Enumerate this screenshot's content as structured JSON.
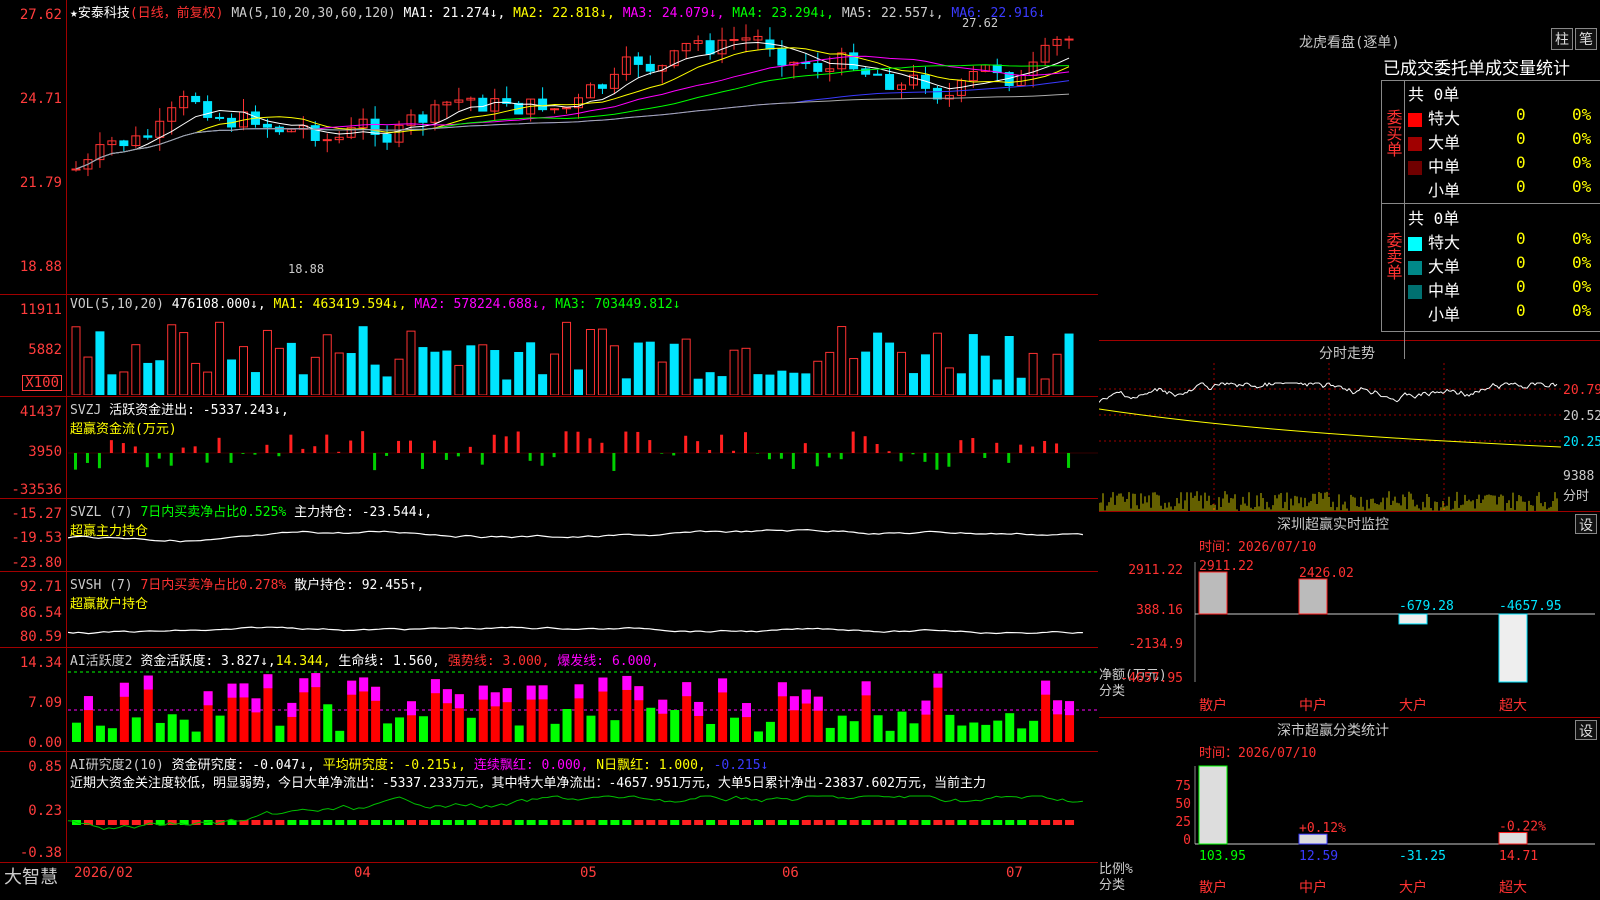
{
  "chart_header": {
    "star": "★",
    "stock": "安泰科技",
    "mode": "(日线，前复权)",
    "ma_prefix": "MA(5,10,20,30,60,120)",
    "ma1": "MA1: 21.274↓,",
    "ma2": "MA2: 22.818↓,",
    "ma3": "MA3: 24.079↓,",
    "ma4": "MA4: 23.294↓,",
    "ma5": "MA5: 22.557↓,",
    "ma6": "MA6: 22.916↓",
    "max_label": "27.62",
    "min_label": "18.88"
  },
  "colors": {
    "up": "#ff3232",
    "down": "#00e5ff",
    "ma1": "#ffffff",
    "ma2": "#ffff00",
    "ma3": "#ff00ff",
    "ma4": "#00ff00",
    "ma5": "#3a3aff",
    "ma6": "#aaaaaa",
    "axis": "#a00000"
  },
  "price_axis": [
    "27.62",
    "24.71",
    "21.79",
    "18.88"
  ],
  "vol_header": {
    "name": "VOL(5,10,20)",
    "v": "476108.000↓,",
    "m1": "MA1: 463419.594↓,",
    "m2": "MA2: 578224.688↓,",
    "m3": "MA3: 703449.812↓"
  },
  "vol_axis": [
    "11911",
    "5882",
    "X100"
  ],
  "svzj_header": {
    "name": "SVZJ",
    "l1": "活跃资金进出: -5337.243↓,",
    "l2": "超赢资金流(万元)"
  },
  "svzj_axis": [
    "41437",
    "3950",
    "-33536"
  ],
  "svzl_header": {
    "name": "SVZL (7)",
    "l1": "7日内买卖净占比0.525%",
    "l2": "主力持仓: -23.544↓,",
    "l3": "超赢主力持仓"
  },
  "svzl_axis": [
    "-15.27",
    "-19.53",
    "-23.80"
  ],
  "svsh_header": {
    "name": "SVSH (7)",
    "l1": "7日内买卖净占比0.278%",
    "l2": "散户持仓: 92.455↑,",
    "l3": "超赢散户持仓"
  },
  "svsh_axis": [
    "92.71",
    "86.54",
    "80.59"
  ],
  "ai1_header": {
    "name": "AI活跃度2",
    "l1": "资金活跃度: 3.827↓,",
    "l2": "14.344,",
    "l3": "生命线: 1.560,",
    "l4": "强势线: 3.000,",
    "l5": "爆发线: 6.000,"
  },
  "ai1_axis": [
    "14.34",
    "7.09",
    "0.00"
  ],
  "ai2_header": {
    "name": "AI研究度2(10)",
    "l1": "资金研究度: -0.047↓,",
    "l2": "平均研究度: -0.215↓,",
    "l3": "连续飘红: 0.000,",
    "l4": "N日飘红: 1.000,",
    "l5": "-0.215↓"
  },
  "ai2_text": "近期大资金关注度较低，明显弱势，今日大单净流出：-5337.233万元，其中特大单净流出：-4657.951万元，大单5日累计净出-23837.602万元，当前主力",
  "ai2_axis": [
    "0.85",
    "0.23",
    "-0.38"
  ],
  "footer": {
    "brand": "大智慧",
    "dates": [
      "2026/02",
      "04",
      "05",
      "06",
      "07"
    ]
  },
  "longhu": {
    "title": "龙虎看盘(逐单)",
    "btn1": "柱",
    "btn2": "笔",
    "tabs": "已成交委托单成交量统计",
    "buy": {
      "label": "委买单",
      "total": "共 0单",
      "rows": [
        {
          "name": "特大",
          "v": "0",
          "p": "0%"
        },
        {
          "name": "大单",
          "v": "0",
          "p": "0%"
        },
        {
          "name": "中单",
          "v": "0",
          "p": "0%"
        },
        {
          "name": "小单",
          "v": "0",
          "p": "0%"
        }
      ]
    },
    "sell": {
      "label": "委卖单",
      "total": "共 0单",
      "rows": [
        {
          "name": "特大",
          "v": "0",
          "p": "0%"
        },
        {
          "name": "大单",
          "v": "0",
          "p": "0%"
        },
        {
          "name": "中单",
          "v": "0",
          "p": "0%"
        },
        {
          "name": "小单",
          "v": "0",
          "p": "0%"
        }
      ]
    }
  },
  "fenshi": {
    "title": "分时走势",
    "axis": [
      "20.79",
      "20.52",
      "20.25"
    ],
    "vol": "9388",
    "label": "分时"
  },
  "realtime": {
    "title": "深圳超赢实时监控",
    "btn": "设",
    "time": "时间：2026/07/10",
    "axis": [
      "2911.22",
      "388.16",
      "-2134.9",
      "-4657.95"
    ],
    "ylabel": "净额(万元)",
    "xlabel": "分类",
    "bars": [
      {
        "cat": "散户",
        "v": "2911.22"
      },
      {
        "cat": "中户",
        "v": "2426.02"
      },
      {
        "cat": "大户",
        "v": "-679.28"
      },
      {
        "cat": "超大",
        "v": "-4657.95"
      }
    ]
  },
  "classify": {
    "title": "深市超赢分类统计",
    "btn": "设",
    "time": "时间：2026/07/10",
    "axis": [
      "75",
      "50",
      "25",
      "0"
    ],
    "ylabel": "比例%",
    "xlabel": "分类",
    "bars": [
      {
        "cat": "散户",
        "v": "103.95",
        "pct": ""
      },
      {
        "cat": "中户",
        "v": "12.59",
        "pct": "+0.12%"
      },
      {
        "cat": "大户",
        "v": "-31.25",
        "pct": ""
      },
      {
        "cat": "超大",
        "v": "14.71",
        "pct": "-0.22%"
      }
    ]
  }
}
